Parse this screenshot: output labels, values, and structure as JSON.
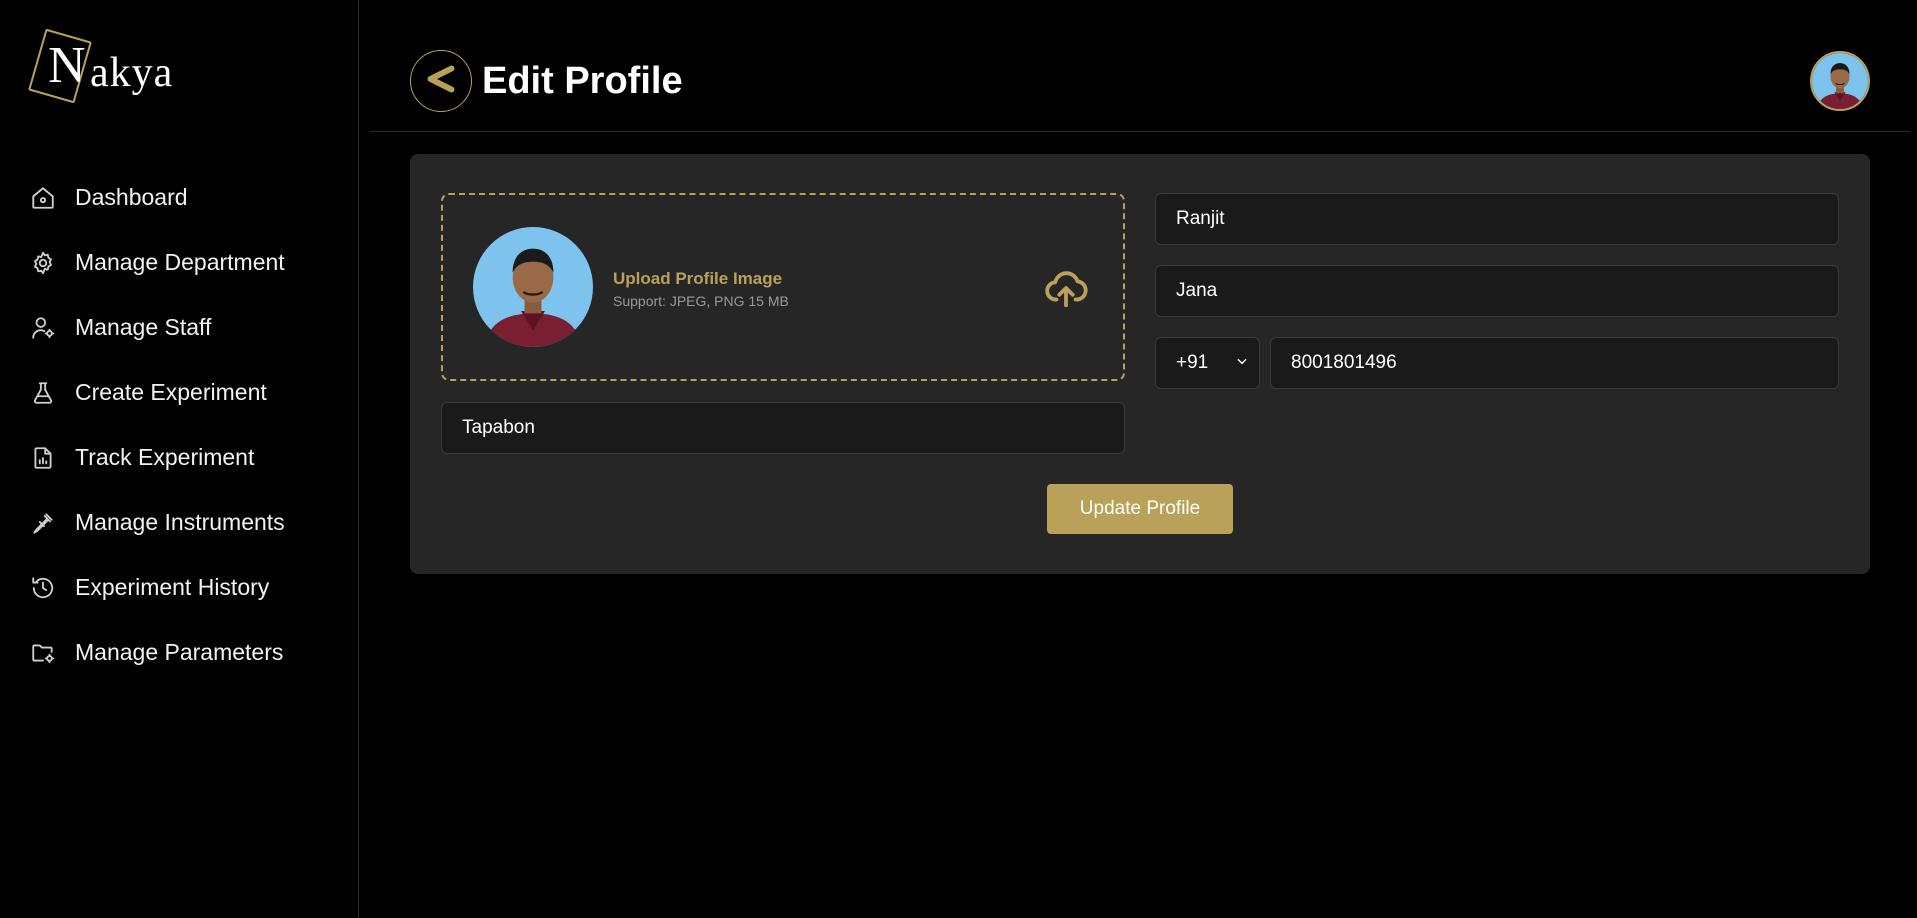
{
  "brand": {
    "logo_letter": "N",
    "logo_rest": "akya",
    "accent": "#b9a15a"
  },
  "sidebar": {
    "items": [
      {
        "label": "Dashboard",
        "icon": "home-icon"
      },
      {
        "label": "Manage Department",
        "icon": "gear-icon"
      },
      {
        "label": "Manage Staff",
        "icon": "user-gear-icon"
      },
      {
        "label": "Create Experiment",
        "icon": "flask-icon"
      },
      {
        "label": "Track Experiment",
        "icon": "document-chart-icon"
      },
      {
        "label": "Manage Instruments",
        "icon": "pipette-icon"
      },
      {
        "label": "Experiment History",
        "icon": "history-icon"
      },
      {
        "label": "Manage Parameters",
        "icon": "folder-gear-icon"
      }
    ]
  },
  "header": {
    "title": "Edit Profile",
    "back_icon": "chevron-left-icon"
  },
  "upload": {
    "title": "Upload Profile Image",
    "support": "Support: JPEG, PNG 15 MB",
    "icon": "cloud-upload-icon"
  },
  "form": {
    "first_name": "Ranjit",
    "last_name": "Jana",
    "country_code": "+91",
    "phone": "8001801496",
    "city": "Tapabon",
    "submit_label": "Update Profile"
  }
}
